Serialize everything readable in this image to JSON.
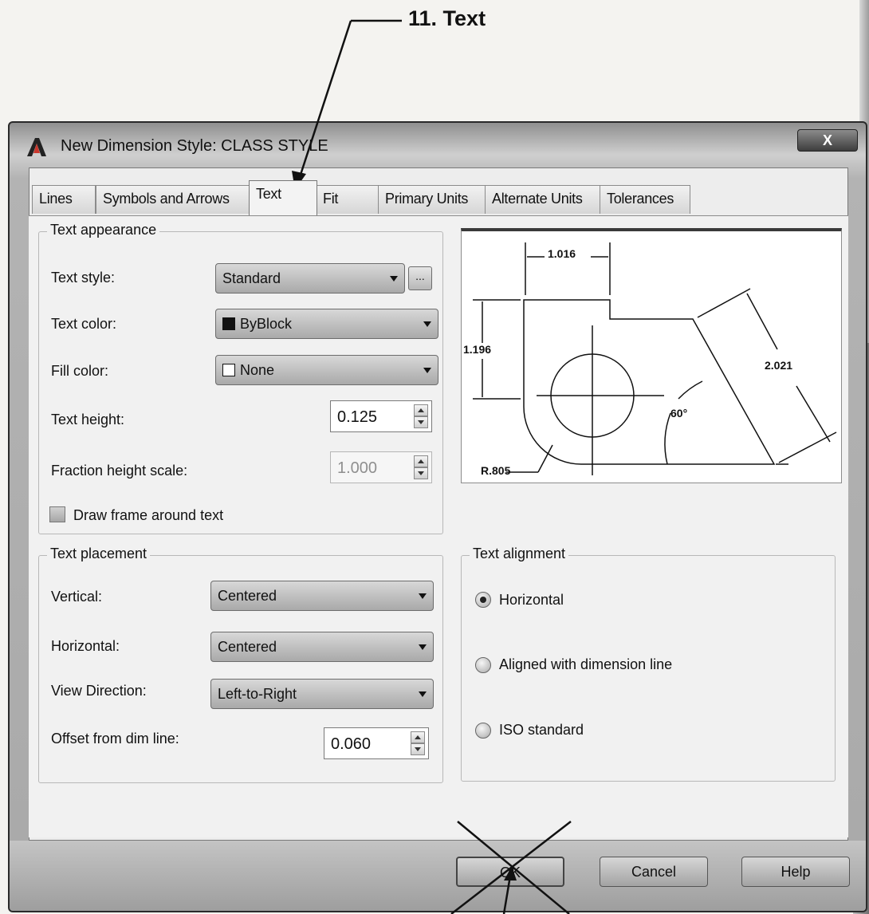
{
  "annotation": {
    "label": "11. Text"
  },
  "window": {
    "title": "New Dimension Style: CLASS STYLE",
    "close_label": "X"
  },
  "tabs": [
    {
      "label": "Lines"
    },
    {
      "label": "Symbols and Arrows"
    },
    {
      "label": "Text",
      "active": true
    },
    {
      "label": "Fit"
    },
    {
      "label": "Primary Units"
    },
    {
      "label": "Alternate Units"
    },
    {
      "label": "Tolerances"
    }
  ],
  "text_appearance": {
    "title": "Text appearance",
    "text_style": {
      "label": "Text style:",
      "value": "Standard",
      "browse_label": "..."
    },
    "text_color": {
      "label": "Text color:",
      "value": "ByBlock",
      "swatch": "#111111"
    },
    "fill_color": {
      "label": "Fill color:",
      "value": "None",
      "swatch": "#ffffff"
    },
    "text_height": {
      "label": "Text height:",
      "value": "0.125"
    },
    "fraction_height_scale": {
      "label": "Fraction height scale:",
      "value": "1.000"
    },
    "draw_frame": {
      "label": "Draw frame around text",
      "checked": false
    }
  },
  "preview": {
    "labels": {
      "top": "1.016",
      "left": "1.196",
      "right": "2.021",
      "angle": "60°",
      "radius": "R.805"
    }
  },
  "text_placement": {
    "title": "Text placement",
    "vertical": {
      "label": "Vertical:",
      "value": "Centered"
    },
    "horizontal": {
      "label": "Horizontal:",
      "value": "Centered"
    },
    "view_direction": {
      "label": "View Direction:",
      "value": "Left-to-Right"
    },
    "offset": {
      "label": "Offset from dim line:",
      "value": "0.060"
    }
  },
  "text_alignment": {
    "title": "Text alignment",
    "options": [
      {
        "label": "Horizontal",
        "selected": true
      },
      {
        "label": "Aligned with dimension line",
        "selected": false
      },
      {
        "label": "ISO standard",
        "selected": false
      }
    ]
  },
  "buttons": {
    "ok": "OK",
    "cancel": "Cancel",
    "help": "Help"
  },
  "colors": {
    "window_frame": "#2a2a2a",
    "panel": "#f1f1f1",
    "combo": "#b9b9b9"
  }
}
